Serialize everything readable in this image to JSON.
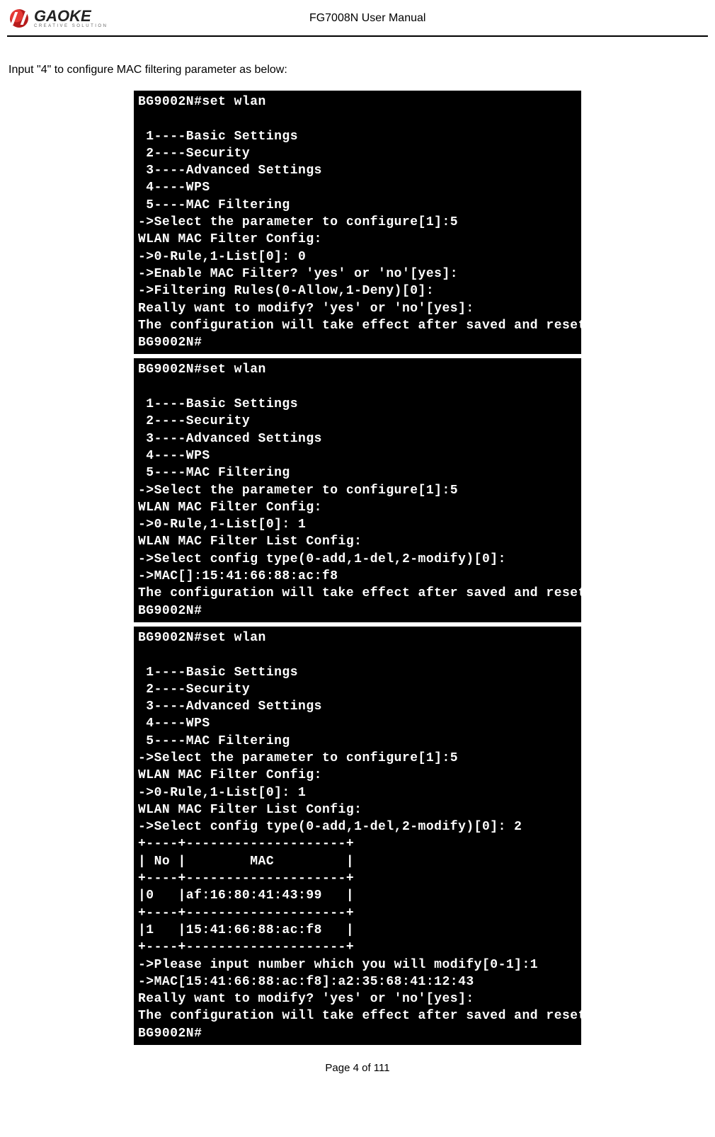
{
  "header": {
    "logo_main": "GAOKE",
    "logo_sub": "CREATIVE SOLUTION",
    "title": "FG7008N User Manual"
  },
  "body_text": "Input \"4\" to configure MAC filtering parameter as below:",
  "terminals": {
    "t1": "BG9002N#set wlan\n\n 1----Basic Settings\n 2----Security\n 3----Advanced Settings\n 4----WPS\n 5----MAC Filtering\n->Select the parameter to configure[1]:5\nWLAN MAC Filter Config:\n->0-Rule,1-List[0]: 0\n->Enable MAC Filter? 'yes' or 'no'[yes]:\n->Filtering Rules(0-Allow,1-Deny)[0]:\nReally want to modify? 'yes' or 'no'[yes]:\nThe configuration will take effect after saved and reset!\nBG9002N#",
    "t2": "BG9002N#set wlan\n\n 1----Basic Settings\n 2----Security\n 3----Advanced Settings\n 4----WPS\n 5----MAC Filtering\n->Select the parameter to configure[1]:5\nWLAN MAC Filter Config:\n->0-Rule,1-List[0]: 1\nWLAN MAC Filter List Config:\n->Select config type(0-add,1-del,2-modify)[0]:\n->MAC[]:15:41:66:88:ac:f8\nThe configuration will take effect after saved and reset!\nBG9002N#",
    "t3": "BG9002N#set wlan\n\n 1----Basic Settings\n 2----Security\n 3----Advanced Settings\n 4----WPS\n 5----MAC Filtering\n->Select the parameter to configure[1]:5\nWLAN MAC Filter Config:\n->0-Rule,1-List[0]: 1\nWLAN MAC Filter List Config:\n->Select config type(0-add,1-del,2-modify)[0]: 2\n+----+--------------------+\n| No |        MAC         |\n+----+--------------------+\n|0   |af:16:80:41:43:99   |\n+----+--------------------+\n|1   |15:41:66:88:ac:f8   |\n+----+--------------------+\n->Please input number which you will modify[0-1]:1\n->MAC[15:41:66:88:ac:f8]:a2:35:68:41:12:43\nReally want to modify? 'yes' or 'no'[yes]:\nThe configuration will take effect after saved and reset!\nBG9002N#"
  },
  "footer": "Page 4 of 111"
}
